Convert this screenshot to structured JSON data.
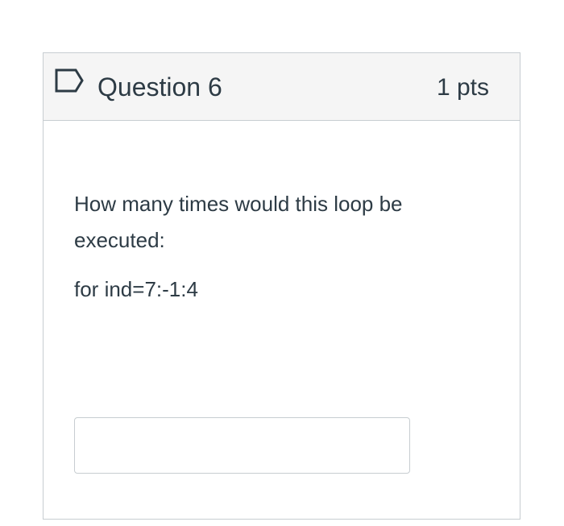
{
  "question": {
    "title": "Question 6",
    "points": "1 pts",
    "flag_icon": "flag-outline-icon",
    "text": "How many times would this loop be executed:",
    "code": "for ind=7:-1:4",
    "answer": {
      "value": "",
      "placeholder": ""
    }
  },
  "colors": {
    "header_background": "#f5f5f5",
    "border": "#c7cdd1",
    "text": "#2d3b45"
  }
}
